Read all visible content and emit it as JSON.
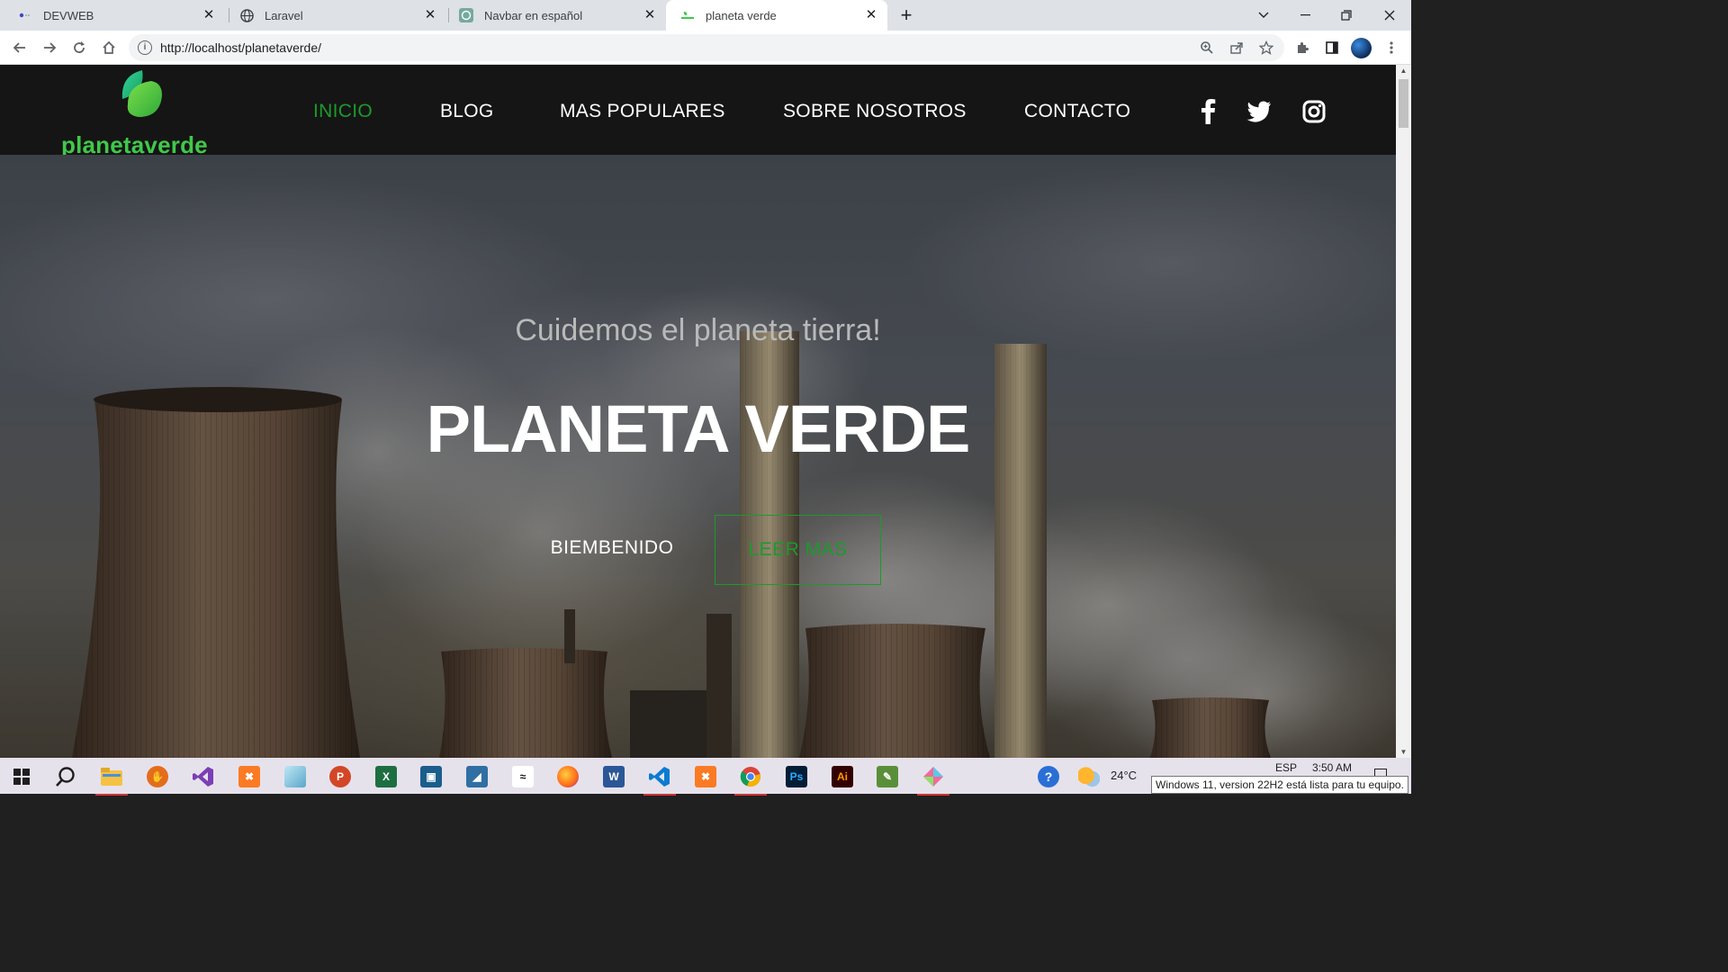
{
  "browser": {
    "tabs": [
      {
        "title": "DEVWEB",
        "favicon": "devweb-icon"
      },
      {
        "title": "Laravel",
        "favicon": "globe-icon"
      },
      {
        "title": "Navbar en español",
        "favicon": "chatgpt-icon"
      },
      {
        "title": "planeta verde",
        "favicon": "leaf-icon",
        "active": true
      }
    ],
    "url": "http://localhost/planetaverde/"
  },
  "site": {
    "logo_text": "planetaverde",
    "nav": {
      "inicio": "INICIO",
      "blog": "BLOG",
      "populares": "MAS POPULARES",
      "nosotros": "SOBRE NOSOTROS",
      "contacto": "CONTACTO"
    },
    "social": [
      "facebook-icon",
      "twitter-icon",
      "instagram-icon"
    ],
    "hero": {
      "subtitle": "Cuidemos el planeta tierra!",
      "title": "PLANETA VERDE",
      "welcome": "BIEMBENIDO",
      "cta": "LEER MAS"
    }
  },
  "colors": {
    "accent": "#1c9a2c",
    "logo": "#41c84a",
    "nav_bg": "#151515"
  },
  "taskbar": {
    "weather": "24°C",
    "language": "ESP",
    "time": "3:50 AM",
    "notification": "Windows 11, version 22H2 está lista para tu equipo."
  }
}
